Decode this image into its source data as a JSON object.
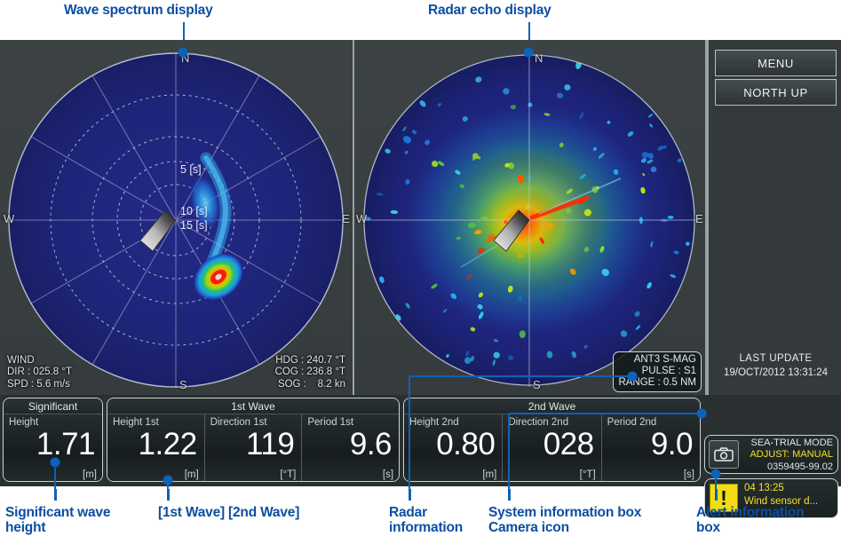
{
  "annotations": {
    "wave_spectrum": "Wave spectrum display",
    "radar_echo": "Radar echo display",
    "significant_wave_height": "Significant wave\nheight",
    "wave_panels": "[1st Wave] [2nd Wave]",
    "radar_information": "Radar\ninformation",
    "system_information": "System information box\nCamera icon",
    "alert_information": "Alert information\nbox"
  },
  "spectrum": {
    "compass": {
      "n": "N",
      "e": "E",
      "s": "S",
      "w": "W"
    },
    "period_rings": [
      "5 [s]",
      "10 [s]",
      "15 [s]"
    ],
    "wind": {
      "title": "WIND",
      "dir_label": "DIR :",
      "dir_value": "025.8 °T",
      "spd_label": "SPD :",
      "spd_value": "5.6 m/s",
      "text": "WIND\nDIR : 025.8 °T\nSPD : 5.6 m/s"
    },
    "nav": {
      "hdg_label": "HDG :",
      "hdg_value": "240.7 °T",
      "cog_label": "COG :",
      "cog_value": "236.8 °T",
      "sog_label": "SOG :",
      "sog_value": "8.2 kn",
      "text": "HDG : 240.7 °T\nCOG : 236.8 °T\nSOG :    8.2 kn"
    }
  },
  "radar": {
    "compass": {
      "n": "N",
      "e": "E",
      "s": "S",
      "w": "W"
    },
    "info": {
      "antenna": "ANT3 S-MAG",
      "pulse": "PULSE : S1",
      "range": "RANGE : 0.5 NM",
      "text": "ANT3 S-MAG\nPULSE : S1\nRANGE : 0.5 NM"
    }
  },
  "sidebar": {
    "menu_label": "MENU",
    "orientation_label": "NORTH UP",
    "last_update_title": "LAST UPDATE",
    "last_update_value": "19/OCT/2012 13:31:24"
  },
  "data_cards": {
    "significant": {
      "title": "Significant",
      "cells": [
        {
          "label": "Height",
          "value": "1.71",
          "unit": "[m]"
        }
      ]
    },
    "wave1": {
      "title": "1st Wave",
      "cells": [
        {
          "label": "Height 1st",
          "value": "1.22",
          "unit": "[m]"
        },
        {
          "label": "Direction 1st",
          "value": "119",
          "unit": "[°T]"
        },
        {
          "label": "Period 1st",
          "value": "9.6",
          "unit": "[s]"
        }
      ]
    },
    "wave2": {
      "title": "2nd Wave",
      "cells": [
        {
          "label": "Height 2nd",
          "value": "0.80",
          "unit": "[m]"
        },
        {
          "label": "Direction 2nd",
          "value": "028",
          "unit": "[°T]"
        },
        {
          "label": "Period 2nd",
          "value": "9.0",
          "unit": "[s]"
        }
      ]
    }
  },
  "system_box": {
    "mode": "SEA-TRIAL MODE",
    "adjust": "ADJUST: MANUAL",
    "serial": "0359495-99.02",
    "camera_icon": "camera-icon"
  },
  "alert_box": {
    "icon": "!",
    "timestamp": "04 13:25",
    "message": "Wind sensor d...",
    "text": "04 13:25\nWind sensor d..."
  },
  "colors": {
    "annotation_blue": "#0b4ea2",
    "screen_background": "#3b4143",
    "scope_background": "#1d2276",
    "alert_yellow": "#f2dd12",
    "panel_border": "#ccd3d6"
  }
}
